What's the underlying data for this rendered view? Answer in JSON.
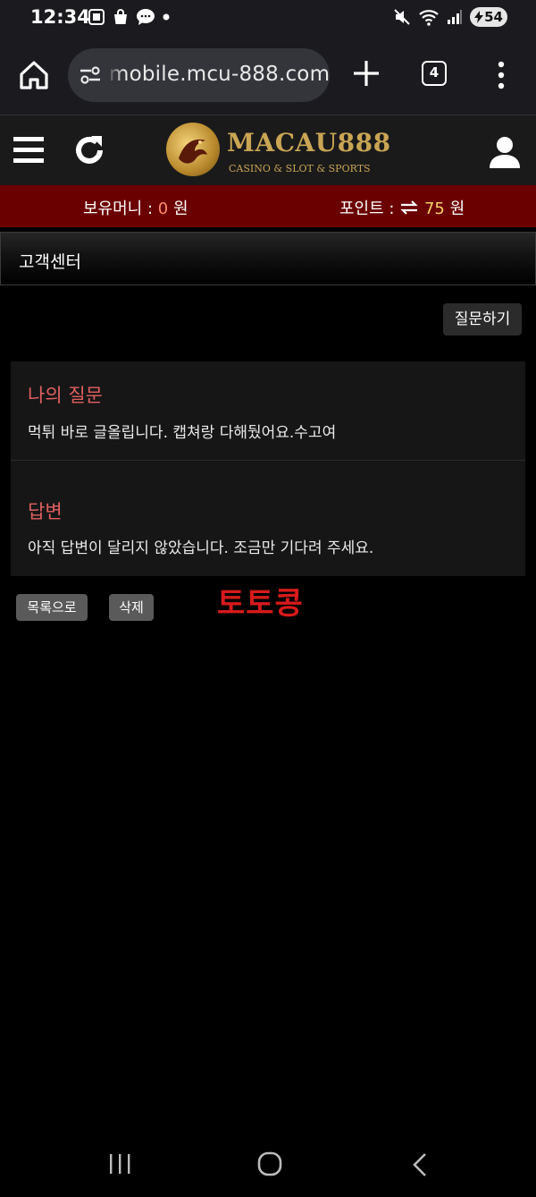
{
  "status_bar": {
    "time": "12:34",
    "battery": "54"
  },
  "browser": {
    "url": "mobile.mcu-888.com",
    "tab_count": "4"
  },
  "site": {
    "logo_title": "MACAU888",
    "logo_subtitle": "CASINO & SLOT & SPORTS"
  },
  "money_bar": {
    "money_label": "보유머니 :",
    "money_value": "0",
    "money_unit": "원",
    "point_label": "포인트 :",
    "point_value": "75",
    "point_unit": "원"
  },
  "page": {
    "title": "고객센터",
    "ask_button": "질문하기"
  },
  "qa": {
    "question_label": "나의 질문",
    "question_text": "먹튀 바로 글올립니다. 캡쳐랑 다해뒀어요.수고여",
    "answer_label": "답변",
    "answer_text": "아직 답변이 달리지 않았습니다. 조금만 기다려 주세요."
  },
  "actions": {
    "list_button": "목록으로",
    "delete_button": "삭제"
  },
  "watermark": "토토콩",
  "colors": {
    "money_bar": "#6b0000",
    "label_red": "#e06060",
    "watermark": "#d61a1a",
    "gold": "#c9a554"
  }
}
